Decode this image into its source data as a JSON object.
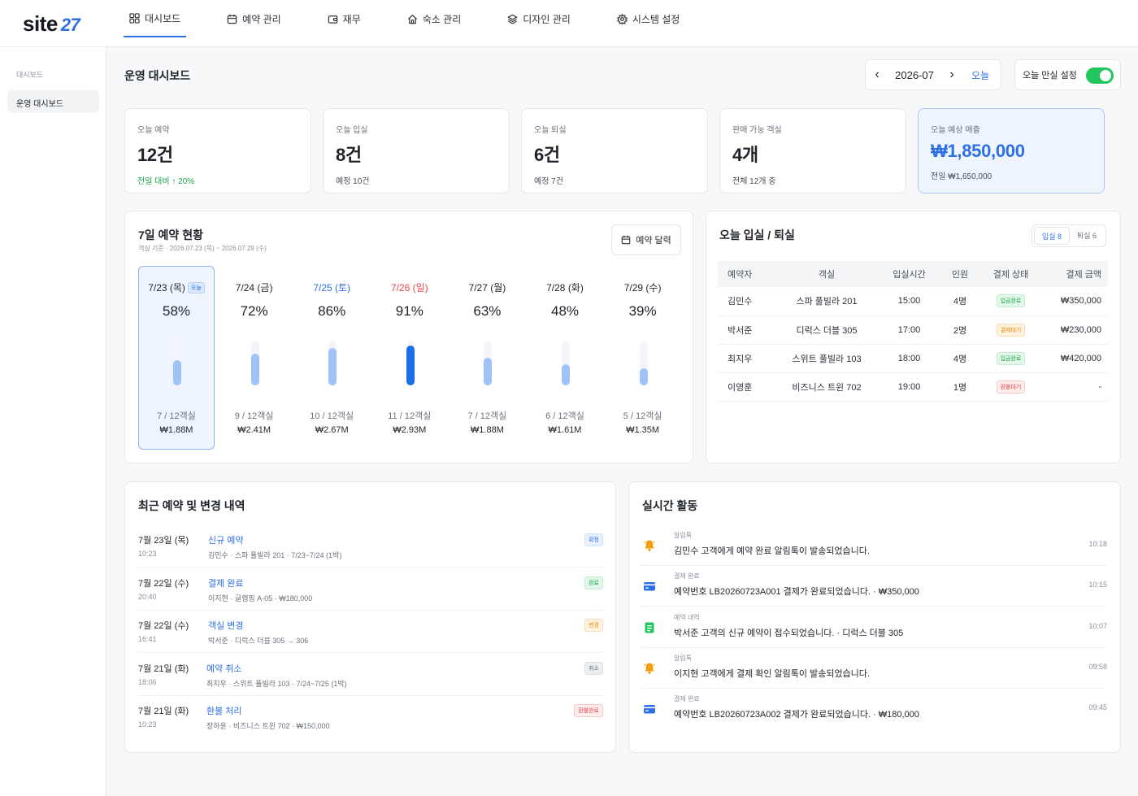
{
  "brand": {
    "name": "site",
    "mark": "27"
  },
  "nav": [
    {
      "label": "대시보드",
      "icon": "grid-icon",
      "active": true
    },
    {
      "label": "예약 관리",
      "icon": "calendar-icon"
    },
    {
      "label": "재무",
      "icon": "wallet-icon"
    },
    {
      "label": "숙소 관리",
      "icon": "home-icon"
    },
    {
      "label": "디자인 관리",
      "icon": "layers-icon"
    },
    {
      "label": "시스템 설정",
      "icon": "gear-icon"
    }
  ],
  "sidebar": {
    "section": "대시보드",
    "items": [
      {
        "label": "운영 대시보드"
      }
    ]
  },
  "header": {
    "title": "운영 대시보드",
    "month": "2026-07",
    "today_label": "오늘",
    "full_label": "오늘 만실 설정",
    "full_enabled": true
  },
  "stats": [
    {
      "label": "오늘 예약",
      "value": "12건",
      "sub": "전일 대비 ↑ 20%"
    },
    {
      "label": "오늘 입실",
      "value": "8건",
      "sub": "예정 10건"
    },
    {
      "label": "오늘 퇴실",
      "value": "6건",
      "sub": "예정 7건"
    },
    {
      "label": "판매 가능 객실",
      "value": "4개",
      "sub": "전체 12개 중"
    },
    {
      "label": "오늘 예상 매출",
      "value": "₩1,850,000",
      "sub": "전일 ₩1,650,000"
    }
  ],
  "week": {
    "title": "7일 예약 현황",
    "subtitle": "객실 기준 · 2026.07.23 (목) ~ 2026.07.29 (수)",
    "calendar_label": "예약 달력",
    "today_badge": "오늘",
    "days": [
      {
        "label": "7/23 (목)",
        "pct": "58%",
        "rate": 0.58,
        "rooms": "7 / 12객실",
        "revenue": "₩1.88M",
        "kind": "weekday",
        "today": true
      },
      {
        "label": "7/24 (금)",
        "pct": "72%",
        "rate": 0.72,
        "rooms": "9 / 12객실",
        "revenue": "₩2.41M",
        "kind": "weekday"
      },
      {
        "label": "7/25 (토)",
        "pct": "86%",
        "rate": 0.86,
        "rooms": "10 / 12객실",
        "revenue": "₩2.67M",
        "kind": "sat"
      },
      {
        "label": "7/26 (일)",
        "pct": "91%",
        "rate": 0.91,
        "rooms": "11 / 12객실",
        "revenue": "₩2.93M",
        "kind": "sun"
      },
      {
        "label": "7/27 (월)",
        "pct": "63%",
        "rate": 0.63,
        "rooms": "7 / 12객실",
        "revenue": "₩1.88M",
        "kind": "weekday"
      },
      {
        "label": "7/28 (화)",
        "pct": "48%",
        "rate": 0.48,
        "rooms": "6 / 12객실",
        "revenue": "₩1.61M",
        "kind": "weekday"
      },
      {
        "label": "7/29 (수)",
        "pct": "39%",
        "rate": 0.39,
        "rooms": "5 / 12객실",
        "revenue": "₩1.35M",
        "kind": "weekday"
      }
    ]
  },
  "inout": {
    "title": "오늘 입실 / 퇴실",
    "tabs": [
      "입실 8",
      "퇴실 6"
    ],
    "columns": [
      "예약자",
      "객실",
      "입실시간",
      "인원",
      "결제 상태",
      "결제 금액"
    ],
    "rows": [
      {
        "guest": "김민수",
        "room": "스파 풀빌라 201",
        "time": "15:00",
        "people": "4명",
        "status": "입금완료",
        "tone": "g",
        "amount": "₩350,000"
      },
      {
        "guest": "박서준",
        "room": "디럭스 더블 305",
        "time": "17:00",
        "people": "2명",
        "status": "결제대기",
        "tone": "o",
        "amount": "₩230,000"
      },
      {
        "guest": "최지우",
        "room": "스위트 풀빌라 103",
        "time": "18:00",
        "people": "4명",
        "status": "입금완료",
        "tone": "g",
        "amount": "₩420,000"
      },
      {
        "guest": "이영훈",
        "room": "비즈니스 트윈 702",
        "time": "19:00",
        "people": "1명",
        "status": "환불대기",
        "tone": "r",
        "amount": "-"
      }
    ]
  },
  "recent": {
    "title": "최근 예약 및 변경 내역",
    "items": [
      {
        "date": "7월 23일 (목)",
        "time": "10:23",
        "type": "신규 예약",
        "desc": "김민수 · 스파 풀빌라 201 · 7/23~7/24 (1박)",
        "badge": "확정",
        "tone": "b"
      },
      {
        "date": "7월 22일 (수)",
        "time": "20:40",
        "type": "결제 완료",
        "desc": "이지현 · 글램핑 A-05 · ₩180,000",
        "badge": "완료",
        "tone": "g"
      },
      {
        "date": "7월 22일 (수)",
        "time": "16:41",
        "type": "객실 변경",
        "desc": "박서준 · 디럭스 더블 305 → 306",
        "badge": "변경",
        "tone": "o"
      },
      {
        "date": "7월 21일 (화)",
        "time": "18:06",
        "type": "예약 취소",
        "desc": "최지우 · 스위트 풀빌라 103 · 7/24~7/25 (1박)",
        "badge": "취소",
        "tone": "gr"
      },
      {
        "date": "7월 21일 (화)",
        "time": "10:23",
        "type": "환불 처리",
        "desc": "장하윤 · 비즈니스 트윈 702 · ₩150,000",
        "badge": "환불완료",
        "tone": "r"
      }
    ]
  },
  "activity": {
    "title": "실시간 활동",
    "items": [
      {
        "category": "알림톡",
        "message": "김민수 고객에게 예약 완료 알림톡이 발송되었습니다.",
        "time": "10:18",
        "icon": "bell-icon"
      },
      {
        "category": "결제 완료",
        "message": "예약번호 LB20260723A001 결제가 완료되었습니다. · ₩350,000",
        "time": "10:15",
        "icon": "card-icon"
      },
      {
        "category": "예약 내역",
        "message": "박서준 고객의 신규 예약이 접수되었습니다. · 디럭스 더블 305",
        "time": "10:07",
        "icon": "document-icon"
      },
      {
        "category": "알림톡",
        "message": "이지현 고객에게 결제 확인 알림톡이 발송되었습니다.",
        "time": "09:58",
        "icon": "bell-icon"
      },
      {
        "category": "결제 완료",
        "message": "예약번호 LB20260723A002 결제가 완료되었습니다. · ₩180,000",
        "time": "09:45",
        "icon": "card-icon"
      }
    ]
  },
  "colors": {
    "accent": "#2f6fe4",
    "success": "#22c55e",
    "bar_light": "#9ec3f7",
    "bar_strong": "#1a6fe8",
    "bell": "#f59e0b"
  }
}
